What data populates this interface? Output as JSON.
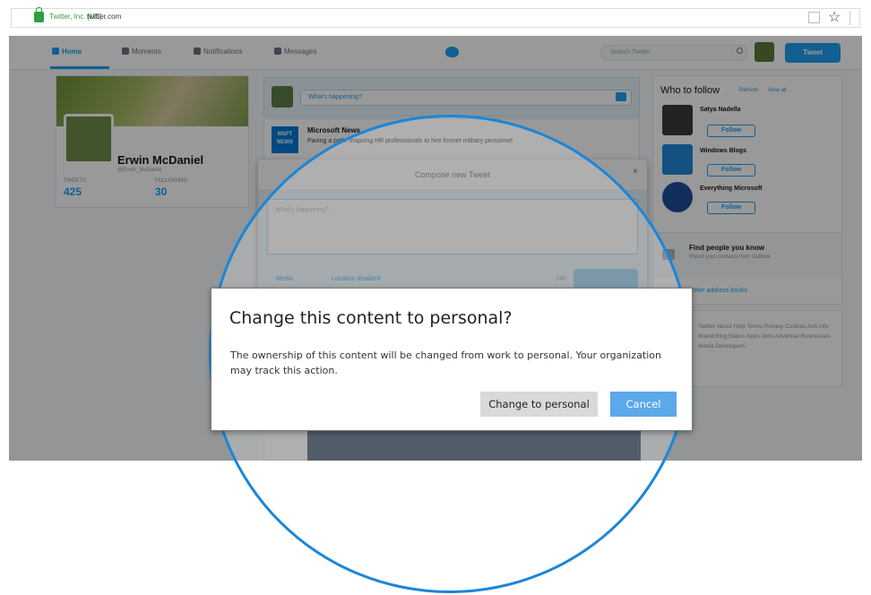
{
  "browser": {
    "certificate": "Twitter, Inc. [US]",
    "url": "twitter.com"
  },
  "twitter_nav": {
    "home": "Home",
    "moments": "Moments",
    "notifications": "Notifications",
    "messages": "Messages",
    "search_placeholder": "Search Twitter",
    "tweet_button": "Tweet"
  },
  "profile": {
    "name": "Erwin McDaniel",
    "handle": "@Erwin_McDaniel",
    "tweets_label": "TWEETS",
    "tweets_value": "425",
    "following_label": "FOLLOWING",
    "following_value": "30"
  },
  "composer": {
    "placeholder": "What's happening?"
  },
  "feed": {
    "author": "Microsoft News",
    "logo_text": "MSFT NEWS",
    "text": "Paving a path: Inspiring HR professionals to hire former military personnel"
  },
  "compose_modal": {
    "title": "Compose new Tweet",
    "close": "×",
    "placeholder": "What's happening?",
    "media": "Media",
    "location": "Location disabled",
    "count": "140"
  },
  "who_to_follow": {
    "title": "Who to follow",
    "refresh": "Refresh",
    "view_all": "View all",
    "follow_label": "Follow",
    "suggestions": [
      {
        "name": "Satya Nadella"
      },
      {
        "name": "Windows Blogs"
      },
      {
        "name": "Everything Microsoft"
      }
    ],
    "find_title": "Find people you know",
    "find_subtitle": "Import your contacts from Outlook",
    "other_tools": "Other address books"
  },
  "footer": {
    "links": "Twitter About Help Terms Privacy Cookies Ads info Brand Blog Status Apps Jobs Advertise Businesses Media Developers"
  },
  "dialog": {
    "title": "Change this content to personal?",
    "message": "The ownership of this content will be changed from work to personal. Your organization may track this action.",
    "change_button": "Change to personal",
    "cancel_button": "Cancel"
  },
  "colors": {
    "twitter_blue": "#1da1f2",
    "cancel_button": "#5ba8ea",
    "zoom_circle": "#1a86d9"
  }
}
